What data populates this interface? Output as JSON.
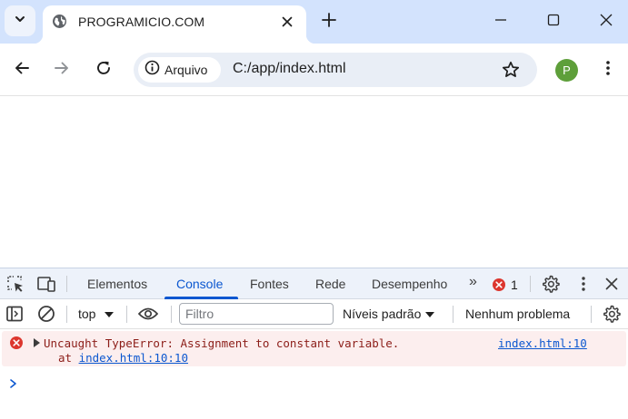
{
  "browser": {
    "tab": {
      "title": "PROGRAMICIO.COM",
      "favicon": "globe-icon"
    },
    "toolbar": {
      "security_chip_label": "Arquivo",
      "url": "C:/app/index.html",
      "profile_initial": "P"
    },
    "colors": {
      "tabstrip": "#d3e3fd",
      "accent": "#0b57d0",
      "avatar": "#5e9f3a"
    }
  },
  "devtools": {
    "tabs": [
      {
        "label": "Elementos",
        "active": false
      },
      {
        "label": "Console",
        "active": true
      },
      {
        "label": "Fontes",
        "active": false
      },
      {
        "label": "Rede",
        "active": false
      },
      {
        "label": "Desempenho",
        "active": false
      }
    ],
    "more_tabs": "»",
    "error_count": "1",
    "console_bar": {
      "context": "top",
      "filter_placeholder": "Filtro",
      "levels": "Níveis padrão",
      "issues": "Nenhum problema"
    },
    "messages": [
      {
        "level": "error",
        "text": "Uncaught TypeError: Assignment to constant variable.",
        "source": "index.html:10",
        "stack_prefix": "at ",
        "stack_link": "index.html:10:10"
      }
    ],
    "prompt_symbol": ">"
  }
}
